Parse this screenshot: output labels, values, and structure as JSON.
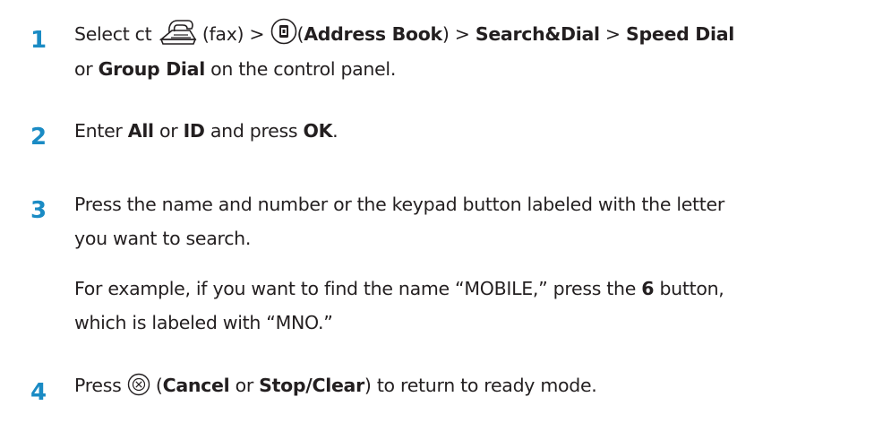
{
  "steps": [
    {
      "number": "1",
      "line1": {
        "t1": "Select ct",
        "t2": "(fax) >",
        "t3": "(",
        "b1": "Address Book",
        "t4": ") >",
        "b2": "Search&Dial",
        "t5": ">",
        "b3": "Speed Dial"
      },
      "line2": {
        "t1": "or",
        "b1": "Group Dial",
        "t2": "on the control panel."
      },
      "icons": [
        "fax-icon",
        "address-book-icon"
      ]
    },
    {
      "number": "2",
      "t1": "Enter",
      "b1": "All",
      "t2": "or",
      "b2": "ID",
      "t3": "and press",
      "b3": "OK",
      "t4": "."
    },
    {
      "number": "3",
      "line1": "Press the name and number or the keypad button labeled with the letter",
      "line2": "you want to search.",
      "para2": {
        "t1": "For example, if you want to find the name “MOBILE,” press the",
        "b1": "6",
        "t2": "button,",
        "line2": "which is labeled with “MNO.”"
      }
    },
    {
      "number": "4",
      "t1": "Press",
      "t2": "(",
      "b1": "Cancel",
      "t3": "or",
      "b2": "Stop/Clear",
      "t4": ") to return to ready mode.",
      "icons": [
        "cancel-icon"
      ]
    }
  ],
  "colors": {
    "step_number": "#1a8bc4",
    "text": "#231f20"
  }
}
